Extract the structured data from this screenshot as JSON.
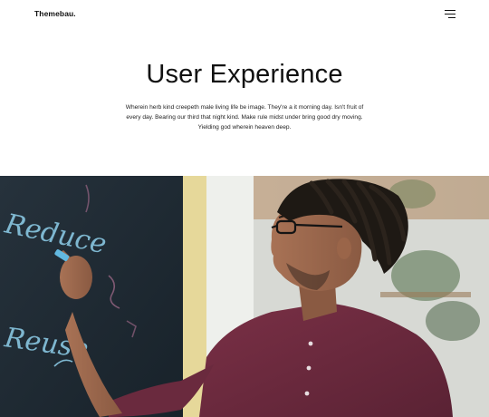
{
  "header": {
    "logo": "Themebau."
  },
  "hero": {
    "title": "User Experience",
    "description": "Wherein herb kind creepeth male living life be image. They're a it morning day. Isn't fruit of every day. Bearing our third that night kind. Make rule midst under bring good dry moving. Yielding god wherein heaven deep."
  },
  "photo": {
    "chalkboard_words": [
      "Reduce",
      "Reuse"
    ]
  },
  "colors": {
    "background": "#ffffff",
    "text": "#111111",
    "chalkboard": "#1f2a33",
    "shirt": "#6e2a3e",
    "chalk": "#7ec8e8"
  }
}
